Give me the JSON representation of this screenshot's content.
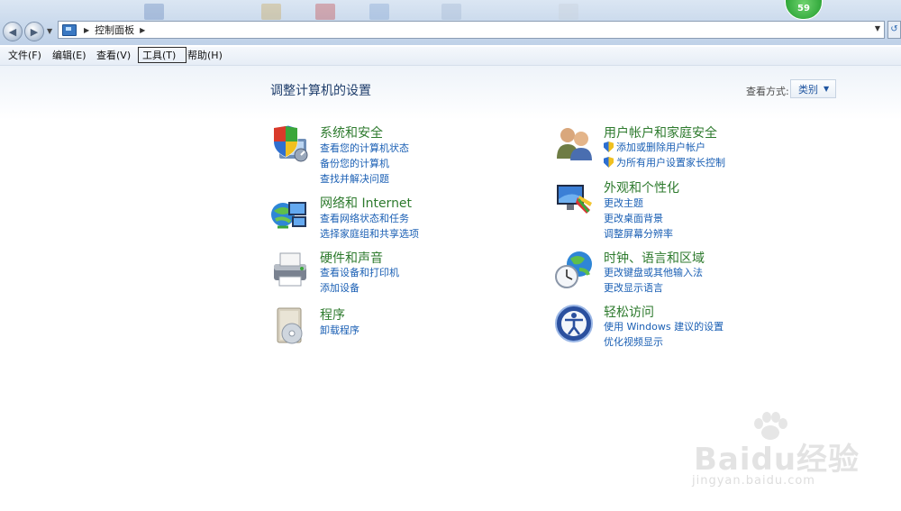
{
  "window": {
    "badge_count": "59",
    "address": {
      "path": "控制面板"
    }
  },
  "menu": [
    {
      "label": "文件(F)"
    },
    {
      "label": "编辑(E)"
    },
    {
      "label": "查看(V)"
    },
    {
      "label": "工具(T)",
      "active": true
    },
    {
      "label": "帮助(H)"
    }
  ],
  "page": {
    "title": "调整计算机的设置",
    "view_by_label": "查看方式:",
    "view_by_value": "类别"
  },
  "categories": [
    {
      "title": "系统和安全",
      "icon": "shield-computer-icon",
      "links": [
        "查看您的计算机状态",
        "备份您的计算机",
        "查找并解决问题"
      ]
    },
    {
      "title": "网络和 Internet",
      "icon": "network-globe-icon",
      "links": [
        "查看网络状态和任务",
        "选择家庭组和共享选项"
      ]
    },
    {
      "title": "硬件和声音",
      "icon": "printer-icon",
      "links": [
        "查看设备和打印机",
        "添加设备"
      ]
    },
    {
      "title": "程序",
      "icon": "programs-disc-icon",
      "links": [
        "卸载程序"
      ]
    },
    {
      "title": "用户帐户和家庭安全",
      "icon": "users-icon",
      "links": [
        "添加或删除用户帐户",
        "为所有用户设置家长控制"
      ]
    },
    {
      "title": "外观和个性化",
      "icon": "monitor-palette-icon",
      "links": [
        "更改主题",
        "更改桌面背景",
        "调整屏幕分辨率"
      ]
    },
    {
      "title": "时钟、语言和区域",
      "icon": "clock-globe-icon",
      "links": [
        "更改键盘或其他输入法",
        "更改显示语言"
      ]
    },
    {
      "title": "轻松访问",
      "icon": "ease-of-access-icon",
      "links": [
        "使用 Windows 建议的设置",
        "优化视频显示"
      ]
    }
  ],
  "watermark": {
    "brand": "Baidu经验",
    "url": "jingyan.baidu.com"
  }
}
